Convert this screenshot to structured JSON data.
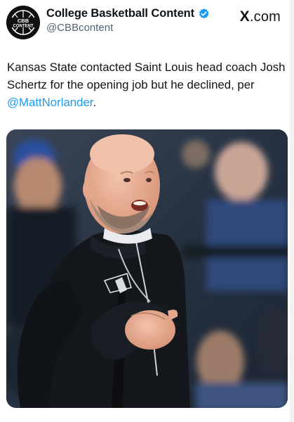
{
  "account": {
    "display_name": "College Basketball Content",
    "handle": "@CBBcontent",
    "avatar_text": [
      "CBB",
      "CONTENT"
    ]
  },
  "site_mark": {
    "letter": "X",
    "suffix": ".com"
  },
  "tweet": {
    "text_before": "Kansas State contacted Saint Louis head coach Josh Schertz for the opening job but he declined, per ",
    "mention": "@MattNorlander",
    "text_after": "."
  },
  "photo": {
    "subject": "coach-photo"
  },
  "colors": {
    "accent": "#1d9bf0",
    "text": "#0f1419",
    "muted": "#536471"
  }
}
